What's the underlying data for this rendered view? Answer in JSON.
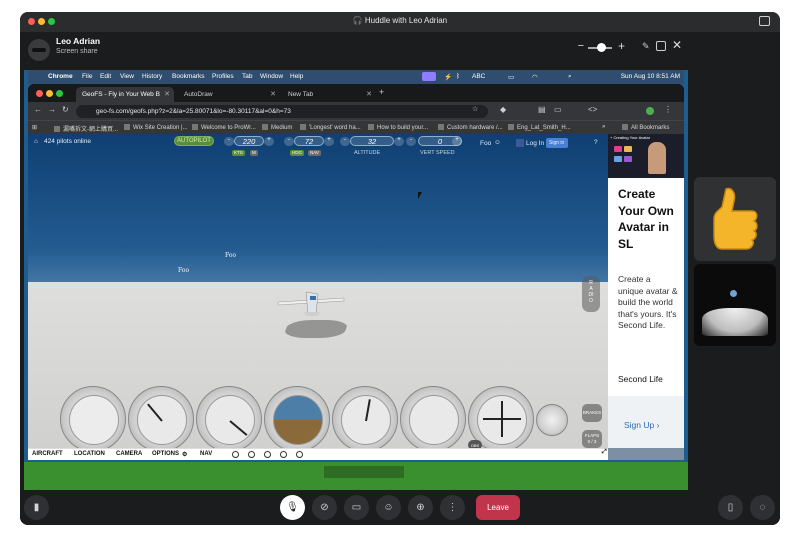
{
  "huddle": {
    "title": "Huddle with Leo Adrian",
    "presenter_name": "Leo Adrian",
    "presenter_status": "Screen share",
    "leave_label": "Leave"
  },
  "mac_menu": {
    "app": "Chrome",
    "items": [
      "File",
      "Edit",
      "View",
      "History",
      "Bookmarks",
      "Profiles",
      "Tab",
      "Window",
      "Help"
    ],
    "abc": "ABC",
    "clock": "Sun Aug 10  8:51 AM"
  },
  "chrome": {
    "tabs": [
      {
        "label": "GeoFS - Fly in Your Web B"
      },
      {
        "label": "AutoDraw"
      },
      {
        "label": "New Tab"
      }
    ],
    "url": "geo-fs.com/geofs.php?z=2&la=25.80071&lo=-80.30117&al=0&h=73",
    "bookmarks": [
      "漏嘴拆文-網上購買...",
      "Wix Site Creation |...",
      "Welcome to ProWr...",
      "Medium",
      "'Longest' word ha...",
      "How to build your...",
      "Custom hardware /...",
      "Eng_Lat_Smith_H...",
      "All Bookmarks"
    ]
  },
  "geofs": {
    "pilots_online": "424 pilots online",
    "autopilot": "AUTOPILOT",
    "speed": "220",
    "speed_units": [
      "KTS",
      "M"
    ],
    "heading": "72",
    "heading_modes": [
      "HDG",
      "NAV"
    ],
    "altitude": "32",
    "altitude_label": "ALTITUDE",
    "vert_speed": "0",
    "vert_speed_label": "VERT SPEED",
    "callsign_top": "Foo",
    "login": "Log In",
    "signin": "Sign in",
    "callsign_mid": "Foo",
    "callsign_left": "Foo",
    "radio": "RADIO",
    "brakes": "BRAKES",
    "flaps": "FLAPS",
    "flaps_value": "0 / 3",
    "obs": "OBS",
    "bottom_menu": [
      "AIRCRAFT",
      "LOCATION",
      "CAMERA",
      "OPTIONS",
      "NAV"
    ]
  },
  "ad": {
    "banner": "+ Creating Your Avatar",
    "title": "Create Your Own Avatar in SL",
    "body": "Create a unique avatar & build the world that's yours. It's Second Life.",
    "brand": "Second Life",
    "cta": "Sign Up"
  },
  "icons": [
    "headphones-icon",
    "expand-icon",
    "pencil-icon",
    "screen-icon",
    "close-icon",
    "mic-icon",
    "video-off-icon",
    "share-screen-icon",
    "emoji-icon",
    "add-person-icon",
    "more-icon",
    "thread-icon",
    "chat-icon"
  ]
}
